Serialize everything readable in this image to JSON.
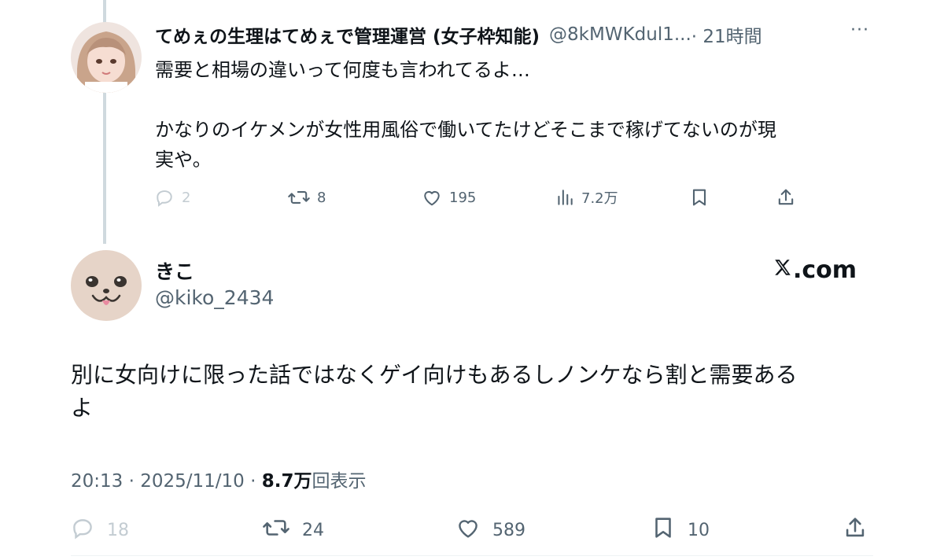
{
  "reply_tweet": {
    "display_name": "てめぇの生理はてめぇで管理運営 (女子枠知能)",
    "handle": "@8kMWKdul1...",
    "time": "· 21時間",
    "more": "···",
    "text": "需要と相場の違いって何度も言われてるよ…\n\nかなりのイケメンが女性用風俗で働いてたけどそこまで稼げてないのが現\n実や。",
    "actions": {
      "replies": "2",
      "reposts": "8",
      "likes": "195",
      "views": "7.2万"
    }
  },
  "main_tweet": {
    "display_name": "きこ",
    "handle": "@kiko_2434",
    "brand": ".com",
    "text": "別に女向けに限った話ではなくゲイ向けもあるしノンケなら割と需要ある\nよ",
    "timestamp": "20:13 · 2025/11/10 · ",
    "views_count": "8.7万",
    "views_label": "回表示",
    "actions": {
      "replies": "18",
      "reposts": "24",
      "likes": "589",
      "bookmarks": "10"
    }
  },
  "colors": {
    "text_primary": "#0f1419",
    "text_secondary": "#536471",
    "thread_line": "#cfd9de",
    "disabled": "#c3ccd2"
  },
  "icons": [
    "reply-icon",
    "repost-icon",
    "like-icon",
    "views-icon",
    "bookmark-icon",
    "share-icon",
    "x-logo-icon"
  ]
}
